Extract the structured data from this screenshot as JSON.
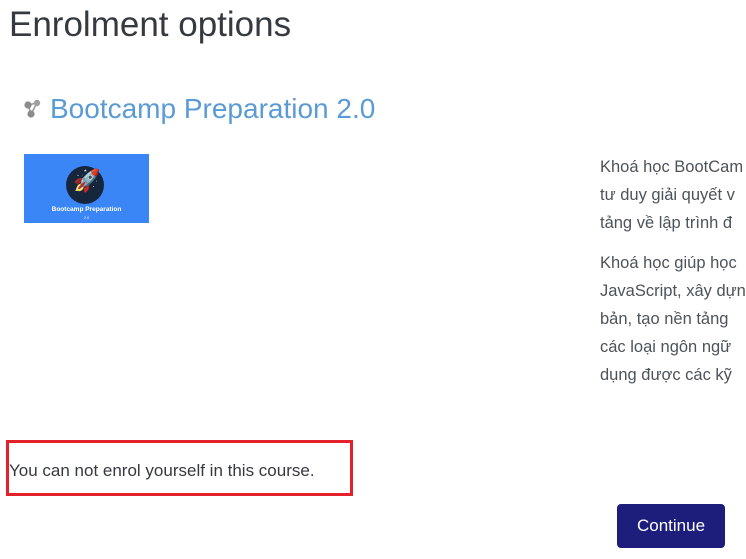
{
  "page": {
    "title": "Enrolment options"
  },
  "course": {
    "name": "Bootcamp Preparation 2.0",
    "icon": "course-network-icon",
    "image": {
      "title": "Bootcamp Preparation",
      "subtitle": "2.0",
      "icon": "rocket-icon",
      "background_color": "#3b86f7"
    },
    "summary": {
      "paragraph1": [
        "Khoá học BootCam",
        "tư duy giải quyết v",
        "tảng về lập trình đ"
      ],
      "paragraph2": [
        "Khoá học giúp học",
        "JavaScript, xây dựn",
        "bản, tạo nền tảng",
        "các loại ngôn ngữ",
        "dụng được các kỹ"
      ]
    }
  },
  "enrolment": {
    "notice": "You can not enrol yourself in this course.",
    "highlight_color": "#e3212a"
  },
  "actions": {
    "continue_label": "Continue",
    "button_color": "#1d1e7c"
  },
  "theme": {
    "link_color": "#5b9bd5"
  }
}
